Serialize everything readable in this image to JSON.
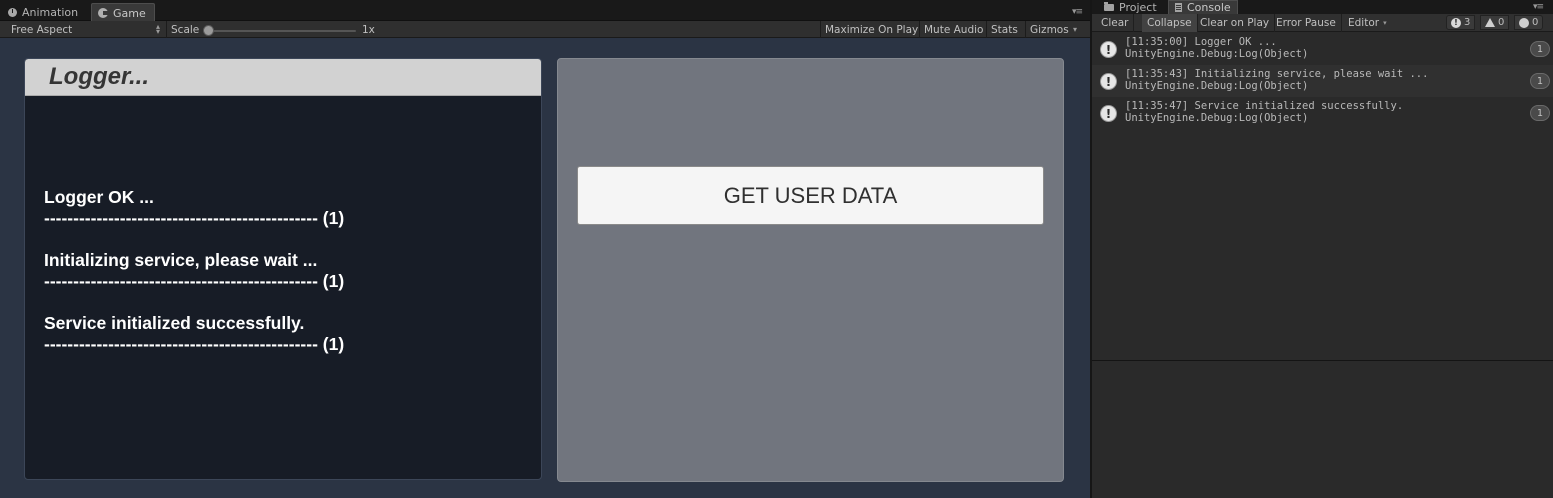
{
  "game_window": {
    "tabs": [
      {
        "label": "Animation",
        "icon": "animation-icon"
      },
      {
        "label": "Game",
        "icon": "game-icon"
      }
    ],
    "toolbar": {
      "aspect": "Free Aspect",
      "scale_label": "Scale",
      "scale_value": "1x",
      "maximize": "Maximize On Play",
      "mute": "Mute Audio",
      "stats": "Stats",
      "gizmos": "Gizmos"
    }
  },
  "game": {
    "logger": {
      "title": "Logger...",
      "entries": [
        {
          "message": "Logger OK ...",
          "separator": "----------------------------------------------- (1)"
        },
        {
          "message": "Initializing service, please wait ...",
          "separator": "----------------------------------------------- (1)"
        },
        {
          "message": "Service initialized successfully.",
          "separator": "----------------------------------------------- (1)"
        }
      ]
    },
    "button_label": "GET USER DATA"
  },
  "console": {
    "tabs": [
      {
        "label": "Project",
        "icon": "folder-icon"
      },
      {
        "label": "Console",
        "icon": "console-icon"
      }
    ],
    "toolbar": {
      "clear": "Clear",
      "collapse": "Collapse",
      "clear_on_play": "Clear on Play",
      "error_pause": "Error Pause",
      "editor": "Editor"
    },
    "counts": {
      "info": "3",
      "warning": "0",
      "error": "0"
    },
    "logs": [
      {
        "line1": "[11:35:00] Logger OK ...",
        "line2": "UnityEngine.Debug:Log(Object)",
        "count": "1"
      },
      {
        "line1": "[11:35:43] Initializing service, please wait ...",
        "line2": "UnityEngine.Debug:Log(Object)",
        "count": "1"
      },
      {
        "line1": "[11:35:47] Service initialized successfully.",
        "line2": "UnityEngine.Debug:Log(Object)",
        "count": "1"
      }
    ]
  }
}
